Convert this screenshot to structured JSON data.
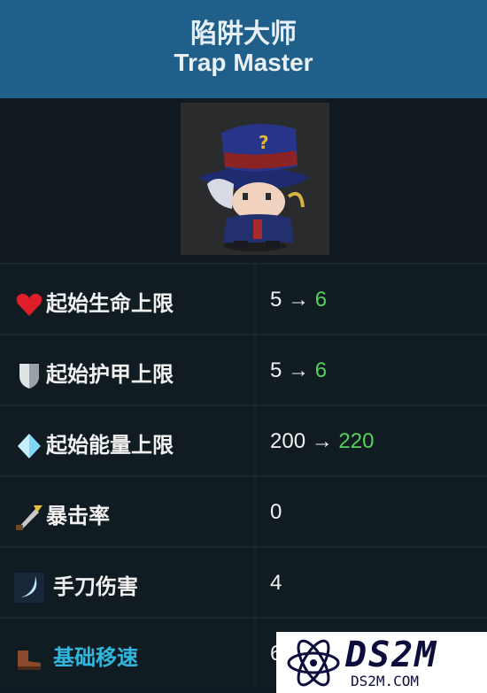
{
  "header": {
    "title_cn": "陷阱大师",
    "title_en": "Trap Master"
  },
  "character": {
    "portrait_icon": "trap-master-portrait"
  },
  "stats": [
    {
      "icon": "heart-icon",
      "label": "起始生命上限",
      "from": "5",
      "arrow": "→",
      "to": "6",
      "label_color": "#f1f1f1"
    },
    {
      "icon": "shield-icon",
      "label": "起始护甲上限",
      "from": "5",
      "arrow": "→",
      "to": "6",
      "label_color": "#f1f1f1"
    },
    {
      "icon": "energy-crystal-icon",
      "label": "起始能量上限",
      "from": "200",
      "arrow": "→",
      "to": "220",
      "label_color": "#f1f1f1"
    },
    {
      "icon": "crit-blade-icon",
      "label": "暴击率",
      "value": "0",
      "label_color": "#f1f1f1"
    },
    {
      "icon": "hand-knife-icon",
      "label": "手刀伤害",
      "value": "4",
      "label_color": "#f1f1f1"
    },
    {
      "icon": "boot-icon",
      "label": "基础移速",
      "value": "6",
      "label_color": "#30b6df"
    }
  ],
  "watermark": {
    "brand": "DS2M",
    "domain": "DS2M.COM"
  },
  "colors": {
    "header_bg": "#1f5f8a",
    "row_bg": "#111c22",
    "increase": "#53d25a"
  }
}
